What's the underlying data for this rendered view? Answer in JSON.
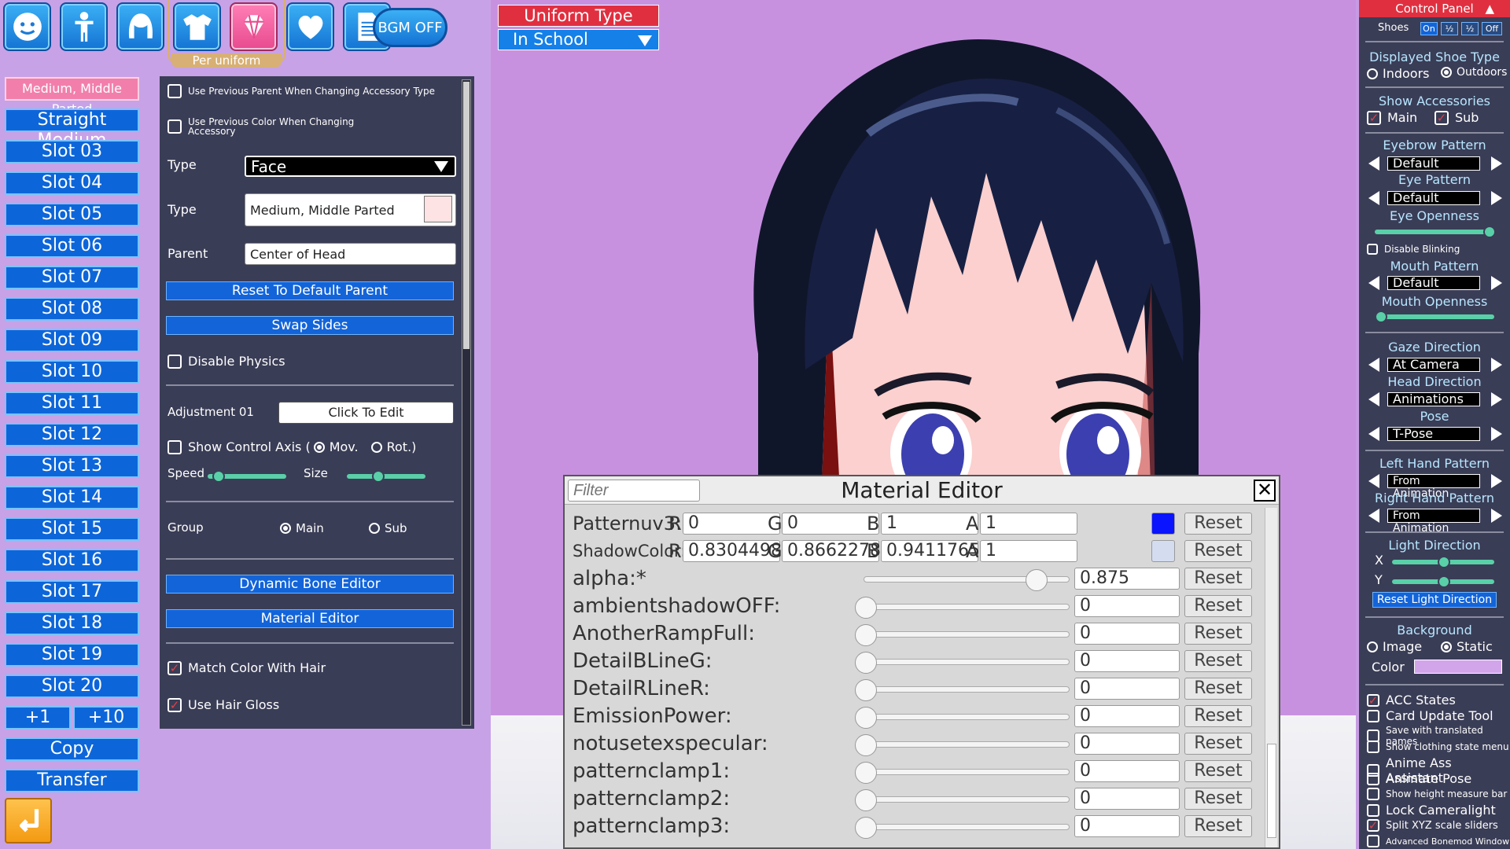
{
  "top_icons": [
    {
      "name": "face-icon"
    },
    {
      "name": "body-icon"
    },
    {
      "name": "hair-icon"
    },
    {
      "name": "clothing-icon"
    },
    {
      "name": "accessory-gem-icon"
    },
    {
      "name": "heart-icon"
    },
    {
      "name": "document-icon"
    }
  ],
  "per_uniform": "Per uniform",
  "bgm_label": "BGM OFF",
  "slots": [
    "Medium, Middle Parted",
    "Straight Medium",
    "Slot 03",
    "Slot 04",
    "Slot 05",
    "Slot 06",
    "Slot 07",
    "Slot 08",
    "Slot 09",
    "Slot 10",
    "Slot 11",
    "Slot 12",
    "Slot 13",
    "Slot 14",
    "Slot 15",
    "Slot 16",
    "Slot 17",
    "Slot 18",
    "Slot 19",
    "Slot 20"
  ],
  "slot_actions": {
    "plus1": "+1",
    "plus10": "+10",
    "copy": "Copy",
    "transfer": "Transfer"
  },
  "accessory": {
    "use_prev_parent": "Use Previous Parent When Changing Accessory Type",
    "use_prev_color": "Use Previous Color When Changing Accessory",
    "type_label": "Type",
    "type_value": "Face",
    "type2_label": "Type",
    "type2_value": "Medium, Middle Parted",
    "parent_label": "Parent",
    "parent_value": "Center of Head",
    "reset_parent": "Reset To Default Parent",
    "swap_sides": "Swap Sides",
    "disable_physics": "Disable Physics",
    "adjustment_label": "Adjustment 01",
    "click_to_edit": "Click To Edit",
    "show_axis": "Show Control Axis (",
    "mov": "Mov.",
    "rot": "Rot.)",
    "speed": "Speed",
    "size": "Size",
    "speed_value": 0.12,
    "size_value": 0.4,
    "group_label": "Group",
    "group_main": "Main",
    "group_sub": "Sub",
    "dynamic_bone": "Dynamic Bone Editor",
    "material_editor": "Material Editor",
    "match_color": "Match Color With Hair",
    "use_gloss": "Use Hair Gloss"
  },
  "uniform": {
    "title": "Uniform Type",
    "value": "In School"
  },
  "control_panel": {
    "title": "Control Panel",
    "shoes_label": "Shoes",
    "shoes_options": [
      "On",
      "½",
      "½",
      "Off"
    ],
    "displayed_shoe": "Displayed Shoe Type",
    "indoors": "Indoors",
    "outdoors": "Outdoors",
    "show_acc": "Show Accessories",
    "main": "Main",
    "sub": "Sub",
    "eyebrow_pattern": "Eyebrow Pattern",
    "eyebrow_value": "Default",
    "eye_pattern": "Eye Pattern",
    "eye_value": "Default",
    "eye_openness": "Eye Openness",
    "disable_blinking": "Disable Blinking",
    "mouth_pattern": "Mouth Pattern",
    "mouth_value": "Default",
    "mouth_openness": "Mouth Openness",
    "gaze_direction": "Gaze Direction",
    "gaze_value": "At Camera",
    "head_direction": "Head Direction",
    "head_value": "Animations",
    "pose": "Pose",
    "pose_value": "T-Pose",
    "left_hand": "Left Hand Pattern",
    "left_hand_value": "From Animation",
    "right_hand": "Right Hand Pattern",
    "right_hand_value": "From Animation",
    "light_direction": "Light Direction",
    "x": "X",
    "y": "Y",
    "reset_light": "Reset Light Direction",
    "background": "Background",
    "image": "Image",
    "static": "Static",
    "color_label": "Color",
    "plugins": [
      {
        "label": "ACC States",
        "checked": true,
        "small": false
      },
      {
        "label": "Card Update Tool",
        "checked": false,
        "small": false
      },
      {
        "label": "Save with translated names",
        "checked": false,
        "small": true
      },
      {
        "label": "Show clothing state menu",
        "checked": false,
        "small": true
      },
      {
        "label": "Anime Ass Assistant",
        "checked": false,
        "small": false
      },
      {
        "label": "Animate Pose",
        "checked": false,
        "small": false
      },
      {
        "label": "Show height measure bar",
        "checked": false,
        "small": true
      },
      {
        "label": "Lock Cameralight",
        "checked": false,
        "small": false
      },
      {
        "label": "Split XYZ scale sliders",
        "checked": true,
        "small": true
      },
      {
        "label": "Advanced Bonemod Window",
        "checked": false,
        "small": true
      }
    ]
  },
  "material_editor": {
    "title": "Material Editor",
    "filter_placeholder": "Filter",
    "reset": "Reset",
    "color_rows": [
      {
        "name": "Patternuv3:",
        "r": "0",
        "g": "0",
        "b": "1",
        "a": "1",
        "swatch": "#0a14ff"
      },
      {
        "name": "ShadowColor:",
        "r": "0.8304498",
        "g": "0.8662278",
        "b": "0.9411765",
        "a": "1",
        "swatch": "#d4ddf0"
      }
    ],
    "float_rows": [
      {
        "name": "alpha:*",
        "value": "0.875",
        "fraction": 0.875
      },
      {
        "name": "ambientshadowOFF:",
        "value": "0",
        "fraction": 0
      },
      {
        "name": "AnotherRampFull:",
        "value": "0",
        "fraction": 0
      },
      {
        "name": "DetailBLineG:",
        "value": "0",
        "fraction": 0
      },
      {
        "name": "DetailRLineR:",
        "value": "0",
        "fraction": 0
      },
      {
        "name": "EmissionPower:",
        "value": "0",
        "fraction": 0
      },
      {
        "name": "notusetexspecular:",
        "value": "0",
        "fraction": 0
      },
      {
        "name": "patternclamp1:",
        "value": "0",
        "fraction": 0
      },
      {
        "name": "patternclamp2:",
        "value": "0",
        "fraction": 0
      },
      {
        "name": "patternclamp3:",
        "value": "0",
        "fraction": 0
      }
    ]
  }
}
